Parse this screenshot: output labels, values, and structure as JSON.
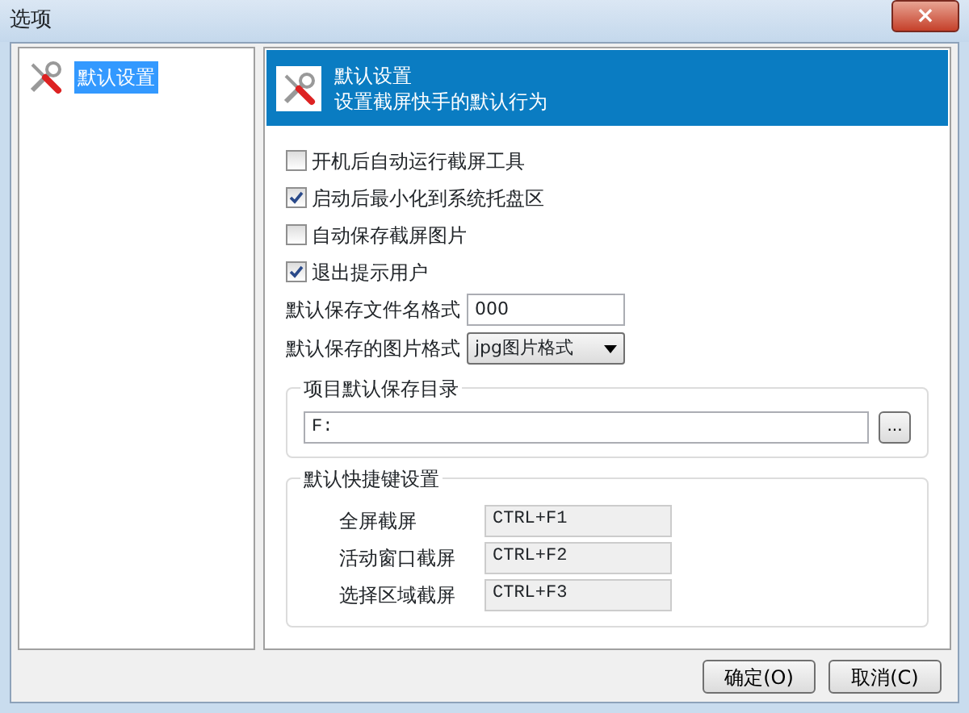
{
  "window": {
    "title": "选项",
    "close": "×"
  },
  "sidebar": {
    "items": [
      {
        "label": "默认设置",
        "selected": true
      }
    ]
  },
  "header": {
    "title": "默认设置",
    "subtitle": "设置截屏快手的默认行为"
  },
  "options": [
    {
      "label": "开机后自动运行截屏工具",
      "checked": false
    },
    {
      "label": "启动后最小化到系统托盘区",
      "checked": true
    },
    {
      "label": "自动保存截屏图片",
      "checked": false
    },
    {
      "label": "退出提示用户",
      "checked": true
    }
  ],
  "filename_format": {
    "label": "默认保存文件名格式",
    "value": "000"
  },
  "image_format": {
    "label": "默认保存的图片格式",
    "value": "jpg图片格式"
  },
  "save_dir": {
    "title": "项目默认保存目录",
    "value": "F:",
    "browse": "..."
  },
  "hotkeys": {
    "title": "默认快捷键设置",
    "rows": [
      {
        "label": "全屏截屏",
        "value": "CTRL+F1"
      },
      {
        "label": "活动窗口截屏",
        "value": "CTRL+F2"
      },
      {
        "label": "选择区域截屏",
        "value": "CTRL+F3"
      }
    ]
  },
  "buttons": [
    "确定(O)",
    "取消(C)"
  ]
}
